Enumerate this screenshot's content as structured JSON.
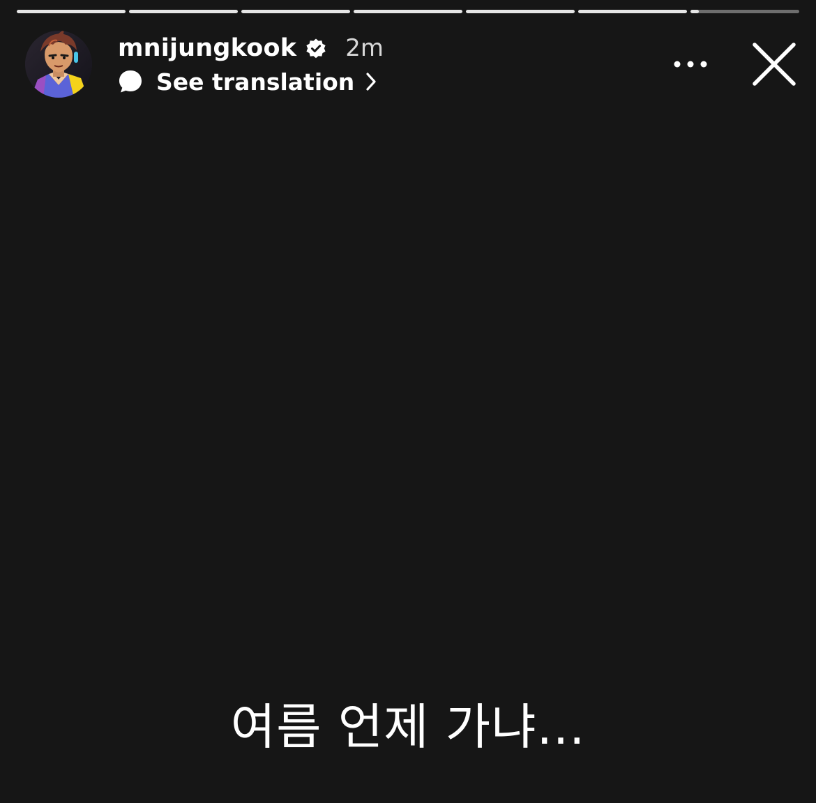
{
  "story": {
    "background_color": "#161616",
    "progress_segments": [
      1,
      1,
      1,
      1,
      1,
      1,
      0.08
    ],
    "account": {
      "username": "mnijungkook",
      "verified": true,
      "verified_icon": "verified-badge-icon",
      "time_ago": "2m",
      "avatar_icon": "profile-avatar"
    },
    "translation": {
      "icon": "chat-bubble-icon",
      "label": "See translation",
      "chevron_icon": "chevron-right-icon"
    },
    "controls": {
      "more_icon": "more-options-icon",
      "close_icon": "close-icon"
    },
    "caption": "여름 언제 가냐..."
  }
}
